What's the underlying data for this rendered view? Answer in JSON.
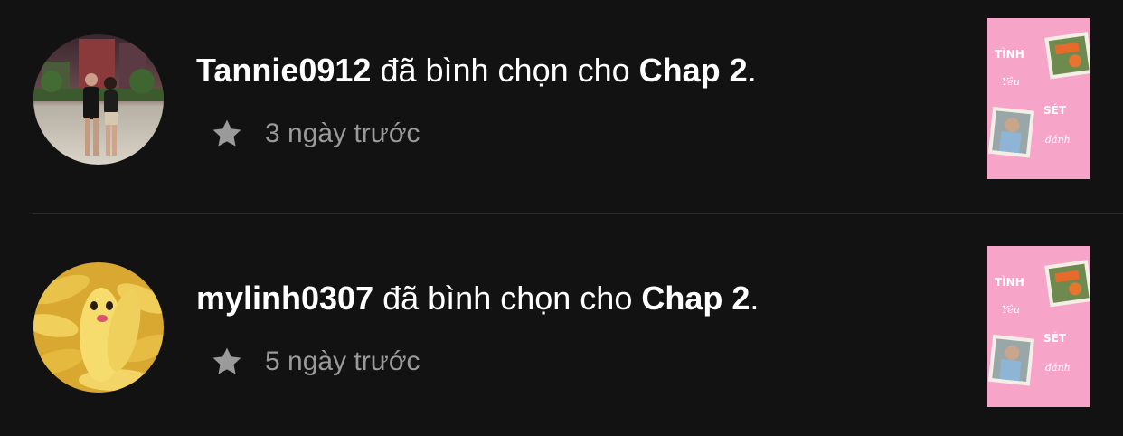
{
  "notifications": [
    {
      "username": "Tannie0912",
      "action_text": " đã bình chọn cho ",
      "chapter": "Chap 2",
      "period": ".",
      "time": "3 ngày trước",
      "icon": "star-icon",
      "avatar": "user-photo-couple"
    },
    {
      "username": "mylinh0307",
      "action_text": " đã bình chọn cho ",
      "chapter": "Chap 2",
      "period": ".",
      "time": "5 ngày trước",
      "icon": "star-icon",
      "avatar": "user-photo-banana"
    }
  ],
  "story_cover": {
    "title_line_1": "TÌNH",
    "title_line_2": "Yêu",
    "title_line_3": "SÉT",
    "title_line_4": "đánh",
    "background_color": "#f6a5c8"
  },
  "colors": {
    "background": "#121212",
    "text_primary": "#ffffff",
    "text_secondary": "#9a9a9a",
    "divider": "#2c2c2c"
  }
}
